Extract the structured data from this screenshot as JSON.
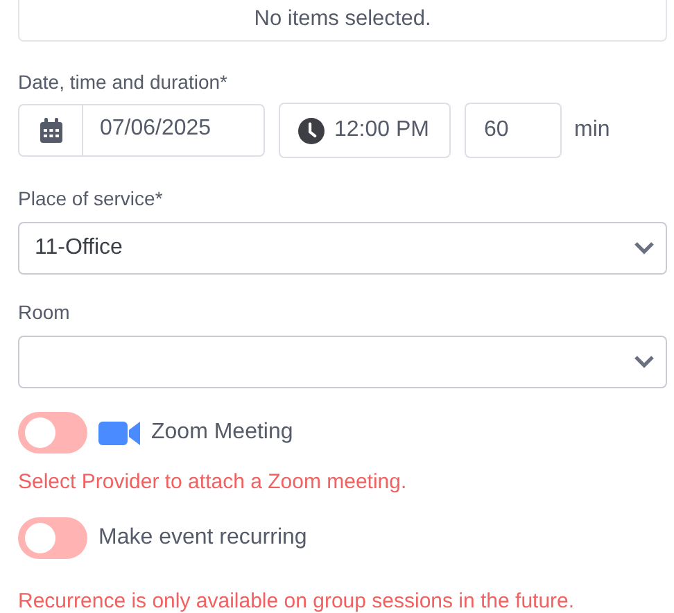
{
  "selection_box": {
    "text": "No items selected."
  },
  "schedule": {
    "label": "Date, time and duration*",
    "date": "07/06/2025",
    "time": "12:00 PM",
    "duration": "60",
    "unit": "min"
  },
  "place_of_service": {
    "label": "Place of service*",
    "value": "11-Office"
  },
  "room": {
    "label": "Room"
  },
  "toggles": [
    {
      "kind": "zoom",
      "label": "Zoom Meeting",
      "on": false,
      "error": "Select Provider to attach a Zoom meeting."
    },
    {
      "kind": "plain",
      "label": "Make event recurring",
      "on": false,
      "error": "Recurrence is only available on group sessions in the future."
    }
  ]
}
